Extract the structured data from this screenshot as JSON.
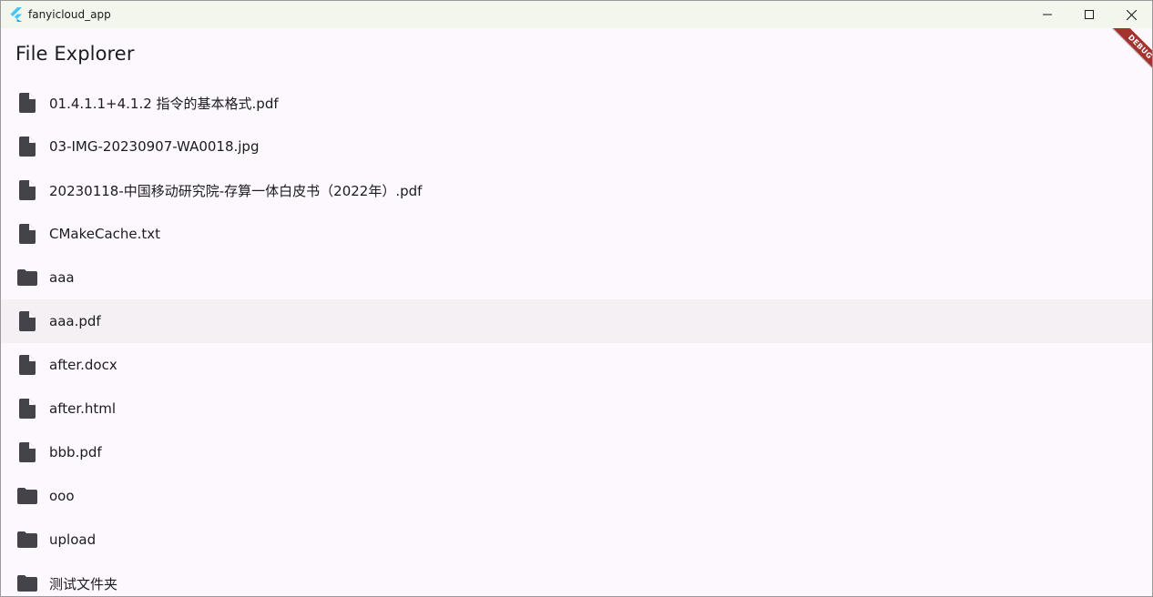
{
  "window": {
    "title": "fanyicloud_app"
  },
  "header": {
    "title": "File Explorer"
  },
  "debug_banner": "DEBUG",
  "files": [
    {
      "name": "01.4.1.1+4.1.2 指令的基本格式.pdf",
      "type": "file"
    },
    {
      "name": "03-IMG-20230907-WA0018.jpg",
      "type": "file"
    },
    {
      "name": "20230118-中国移动研究院-存算一体白皮书（2022年）.pdf",
      "type": "file"
    },
    {
      "name": "CMakeCache.txt",
      "type": "file"
    },
    {
      "name": "aaa",
      "type": "folder"
    },
    {
      "name": "aaa.pdf",
      "type": "file"
    },
    {
      "name": "after.docx",
      "type": "file"
    },
    {
      "name": "after.html",
      "type": "file"
    },
    {
      "name": "bbb.pdf",
      "type": "file"
    },
    {
      "name": "ooo",
      "type": "folder"
    },
    {
      "name": "upload",
      "type": "folder"
    },
    {
      "name": "测试文件夹",
      "type": "folder"
    }
  ],
  "icons": {
    "file": "file-icon",
    "folder": "folder-icon"
  },
  "colors": {
    "background": "#fdf8fd",
    "icon": "#444349",
    "hover_row": "#f4f0f4",
    "debug_ribbon": "#a4332e"
  }
}
